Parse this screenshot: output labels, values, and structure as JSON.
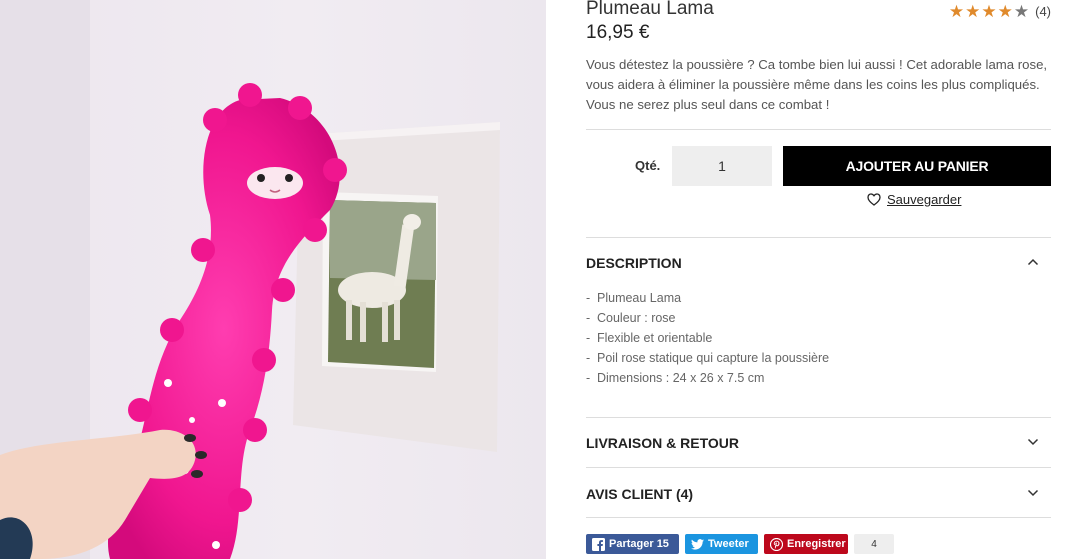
{
  "product": {
    "title": "Plumeau Lama",
    "price": "16,95 €",
    "rating": {
      "stars": 4,
      "max": 5,
      "count": "(4)",
      "star_color": "#777777"
    },
    "intro": "Vous détestez la poussière ? Ca tombe bien lui aussi ! Cet adorable lama rose, vous aidera à éliminer la poussière même dans les coins les plus compliqués. Vous ne serez plus seul dans ce combat !"
  },
  "purchase": {
    "qty_label": "Qté.",
    "qty_value": "1",
    "add_to_cart": "AJOUTER AU PANIER",
    "save_label": "Sauvegarder"
  },
  "accordion": {
    "description_title": "DESCRIPTION",
    "description_items": [
      "Plumeau Lama",
      "Couleur : rose",
      "Flexible et orientable",
      "Poil rose statique qui capture la poussière",
      "Dimensions : 24 x 26 x 7.5 cm"
    ],
    "shipping_title": "LIVRAISON & RETOUR",
    "reviews_title": "AVIS CLIENT (4)"
  },
  "share": {
    "facebook": "Partager 15",
    "twitter": "Tweeter",
    "pinterest": "Enregistrer",
    "pin_count": "4",
    "colors": {
      "facebook": "#3b5998",
      "twitter": "#1b95e0",
      "pinterest": "#bd081c"
    }
  },
  "icons": [
    "heart-icon",
    "chevron-up-icon",
    "chevron-down-icon",
    "facebook-icon",
    "twitter-icon",
    "pinterest-icon",
    "star-icon"
  ],
  "colors": {
    "button_bg": "#000000",
    "duster_pink": "#ff1a9c"
  }
}
